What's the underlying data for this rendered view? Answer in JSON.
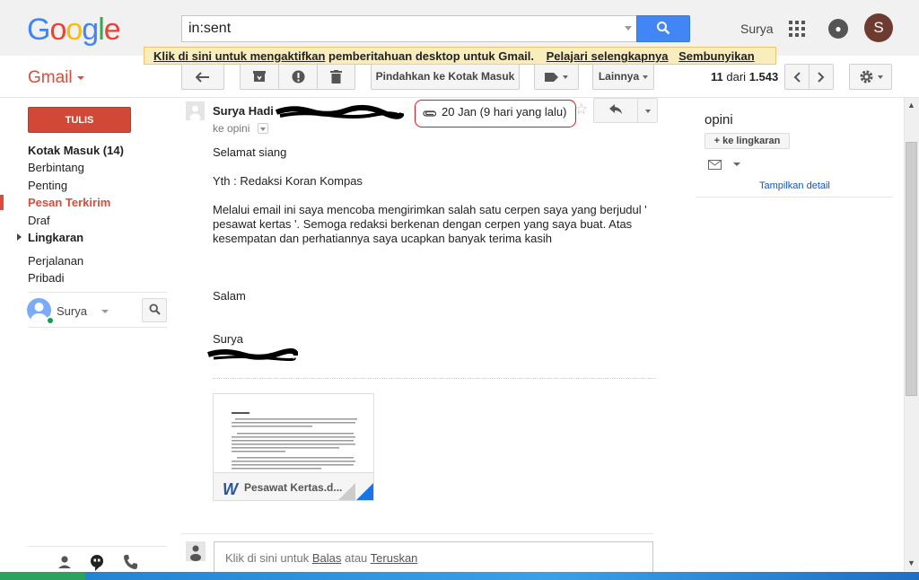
{
  "header": {
    "logo": "Google",
    "search_value": "in:sent",
    "user_name": "Surya",
    "avatar_letter": "S"
  },
  "notification": {
    "enable_link": "Klik di sini untuk mengaktifkan",
    "message": " pemberitahuan desktop untuk Gmail.",
    "learn_more": "Pelajari selengkapnya",
    "hide": "Sembunyikan"
  },
  "toolbar": {
    "gmail_label": "Gmail",
    "move_to_inbox": "Pindahkan ke Kotak Masuk",
    "more": "Lainnya",
    "pager_current": "11",
    "pager_of": "dari",
    "pager_total": "1.543"
  },
  "sidebar": {
    "compose": "TULIS",
    "items": [
      {
        "label": "Kotak Masuk (14)"
      },
      {
        "label": "Berbintang"
      },
      {
        "label": "Penting"
      },
      {
        "label": "Pesan Terkirim"
      },
      {
        "label": "Draf"
      },
      {
        "label": "Lingkaran"
      },
      {
        "label": "Perjalanan"
      },
      {
        "label": "Pribadi"
      }
    ],
    "hangout_user": "Surya"
  },
  "message": {
    "sender": "Surya Hadi",
    "date": "20 Jan (9 hari yang lalu)",
    "to": "ke opini",
    "greeting": "Selamat siang",
    "recipient_line": "Yth : Redaksi Koran Kompas",
    "paragraph": "Melalui email ini saya mencoba mengirimkan salah satu cerpen saya yang berjudul ' pesawat kertas '. Semoga redaksi berkenan dengan cerpen yang saya buat. Atas kesempatan dan perhatiannya saya ucapkan banyak terima kasih",
    "closing": "Salam",
    "signature": "Surya",
    "attachment_name": "Pesawat Kertas.d..."
  },
  "reply": {
    "prefix": "Klik di sini untuk ",
    "reply_link": "Balas",
    "middle": " atau ",
    "forward_link": "Teruskan"
  },
  "contact_panel": {
    "name": "opini",
    "add_circle": "+ ke lingkaran",
    "show_details": "Tampilkan detail"
  },
  "colors": {
    "accent_red": "#dd4b39",
    "search_blue": "#4285f4",
    "highlight_circle": "#e0151b"
  }
}
